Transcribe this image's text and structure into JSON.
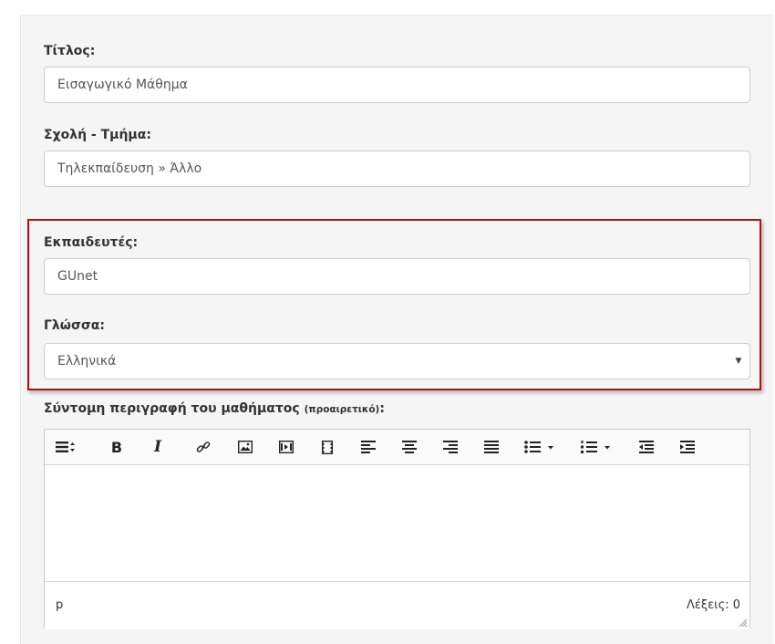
{
  "form": {
    "title_label": "Τίτλος:",
    "title_value": "Εισαγωγικό Μάθημα",
    "faculty_label": "Σχολή - Τμήμα:",
    "faculty_value": "Τηλεκπαίδευση » Άλλο",
    "instructors_label": "Εκπαιδευτές:",
    "instructors_value": "GUnet",
    "language_label": "Γλώσσα:",
    "language_selected": "Ελληνικά",
    "description_label": "Σύντομη περιγραφή του μαθήματος",
    "description_optional": "(προαιρετικό)",
    "description_colon": ":"
  },
  "editor": {
    "toolbar": [
      "format-icon",
      "bold-icon",
      "italic-icon",
      "link-icon",
      "image-icon",
      "media-icon",
      "video-icon",
      "align-left-icon",
      "align-center-icon",
      "align-right-icon",
      "align-justify-icon",
      "bullet-list-icon",
      "numbered-list-icon",
      "outdent-icon",
      "indent-icon"
    ],
    "bold_glyph": "B",
    "italic_glyph": "I",
    "status_path": "p",
    "word_count": "Λέξεις: 0"
  },
  "colors": {
    "highlight_border": "#a8131a",
    "panel_background": "#f5f5f5",
    "input_border": "#cccccc"
  }
}
